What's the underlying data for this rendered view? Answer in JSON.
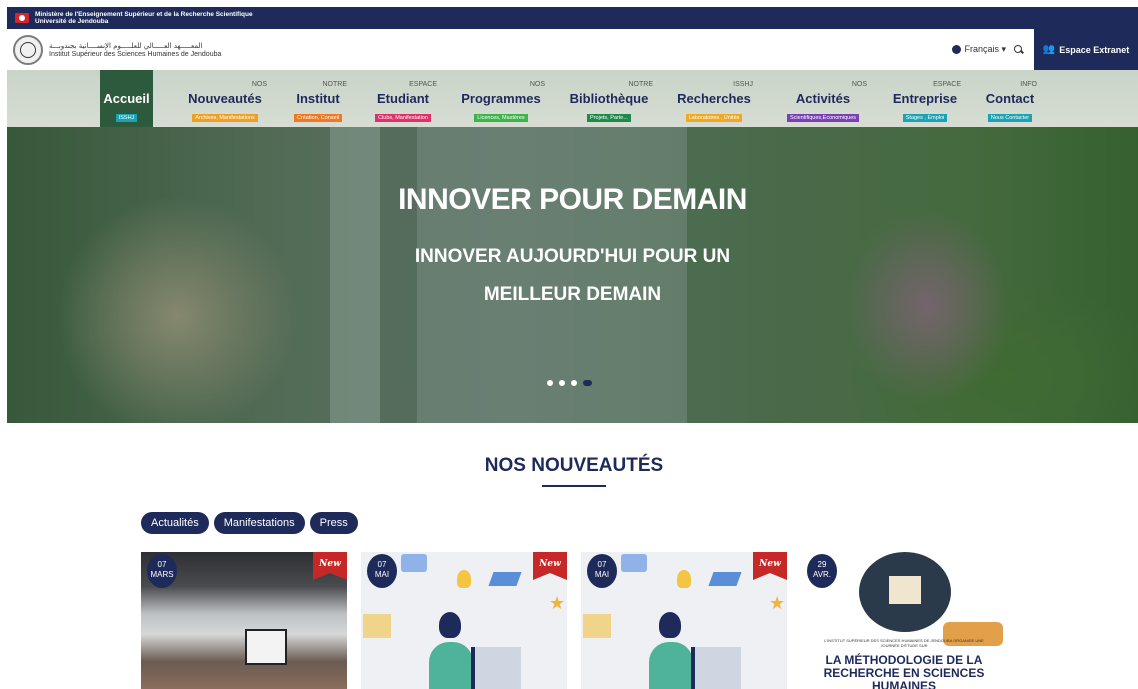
{
  "ministry": {
    "line1": "Ministère de l'Enseignement Supérieur et de la Recherche Scientifique",
    "line2": "Université de Jendouba"
  },
  "header": {
    "institute_ar": "المعـــــهد العـــــالي للعلـــــوم الإنســــانية بجندوبـــة",
    "institute_fr": "Institut Supérieur des Sciences Humaines de Jendouba",
    "language": "Français ▾",
    "extranet_label": "Espace Extranet"
  },
  "nav": {
    "items": [
      {
        "small": "",
        "label": "Accueil",
        "tag": "ISSHJ",
        "tag_color": "#1aa3b5"
      },
      {
        "small": "NOS",
        "label": "Nouveautés",
        "tag": "Archives, Manifestations",
        "tag_color": "#f0a020"
      },
      {
        "small": "NOTRE",
        "label": "Institut",
        "tag": "Création, Conseil",
        "tag_color": "#f07820"
      },
      {
        "small": "ESPACE",
        "label": "Etudiant",
        "tag": "Clubs, Manifestation",
        "tag_color": "#e0306a"
      },
      {
        "small": "NOS",
        "label": "Programmes",
        "tag": "Licences, Mastères",
        "tag_color": "#3bb54a"
      },
      {
        "small": "NOTRE",
        "label": "Bibliothèque",
        "tag": "Projets, Parte...",
        "tag_color": "#1d8a4a"
      },
      {
        "small": "ISSHJ",
        "label": "Recherches",
        "tag": "Laboratoires , Unités",
        "tag_color": "#f0a820"
      },
      {
        "small": "NOS",
        "label": "Activités",
        "tag": "Scientifiques,Economiques",
        "tag_color": "#7a3fb5"
      },
      {
        "small": "ESPACE",
        "label": "Entreprise",
        "tag": "Stages , Emploi",
        "tag_color": "#1aa3b5"
      },
      {
        "small": "INFO",
        "label": "Contact",
        "tag": "Nous Contacter",
        "tag_color": "#1aa3b5"
      }
    ]
  },
  "hero": {
    "title": "INNOVER POUR DEMAIN",
    "subtitle_line1": "INNOVER AUJOURD'HUI POUR UN",
    "subtitle_line2": "MEILLEUR DEMAIN"
  },
  "news": {
    "section_title": "NOS NOUVEAUTÉS",
    "filters": [
      "Actualités",
      "Manifestations",
      "Press"
    ],
    "cards": [
      {
        "day": "07",
        "month": "MARS",
        "badge": "New"
      },
      {
        "day": "07",
        "month": "MAI",
        "badge": "New"
      },
      {
        "day": "07",
        "month": "MAI",
        "badge": "New"
      },
      {
        "day": "29",
        "month": "AVR.",
        "badge": "",
        "poster_small": "L'INSTITUT SUPÉRIEUR DES SCIENCES HUMAINES DE JENDOUBA ORGANISE UNE JOURNÉE D'ÉTUDE SUR",
        "poster_title": "LA MÉTHODOLOGIE DE LA RECHERCHE EN SCIENCES HUMAINES"
      }
    ]
  },
  "colors": {
    "navy": "#1e2a5a",
    "nav_active": "#2d5a3c",
    "new_ribbon": "#c62828"
  }
}
